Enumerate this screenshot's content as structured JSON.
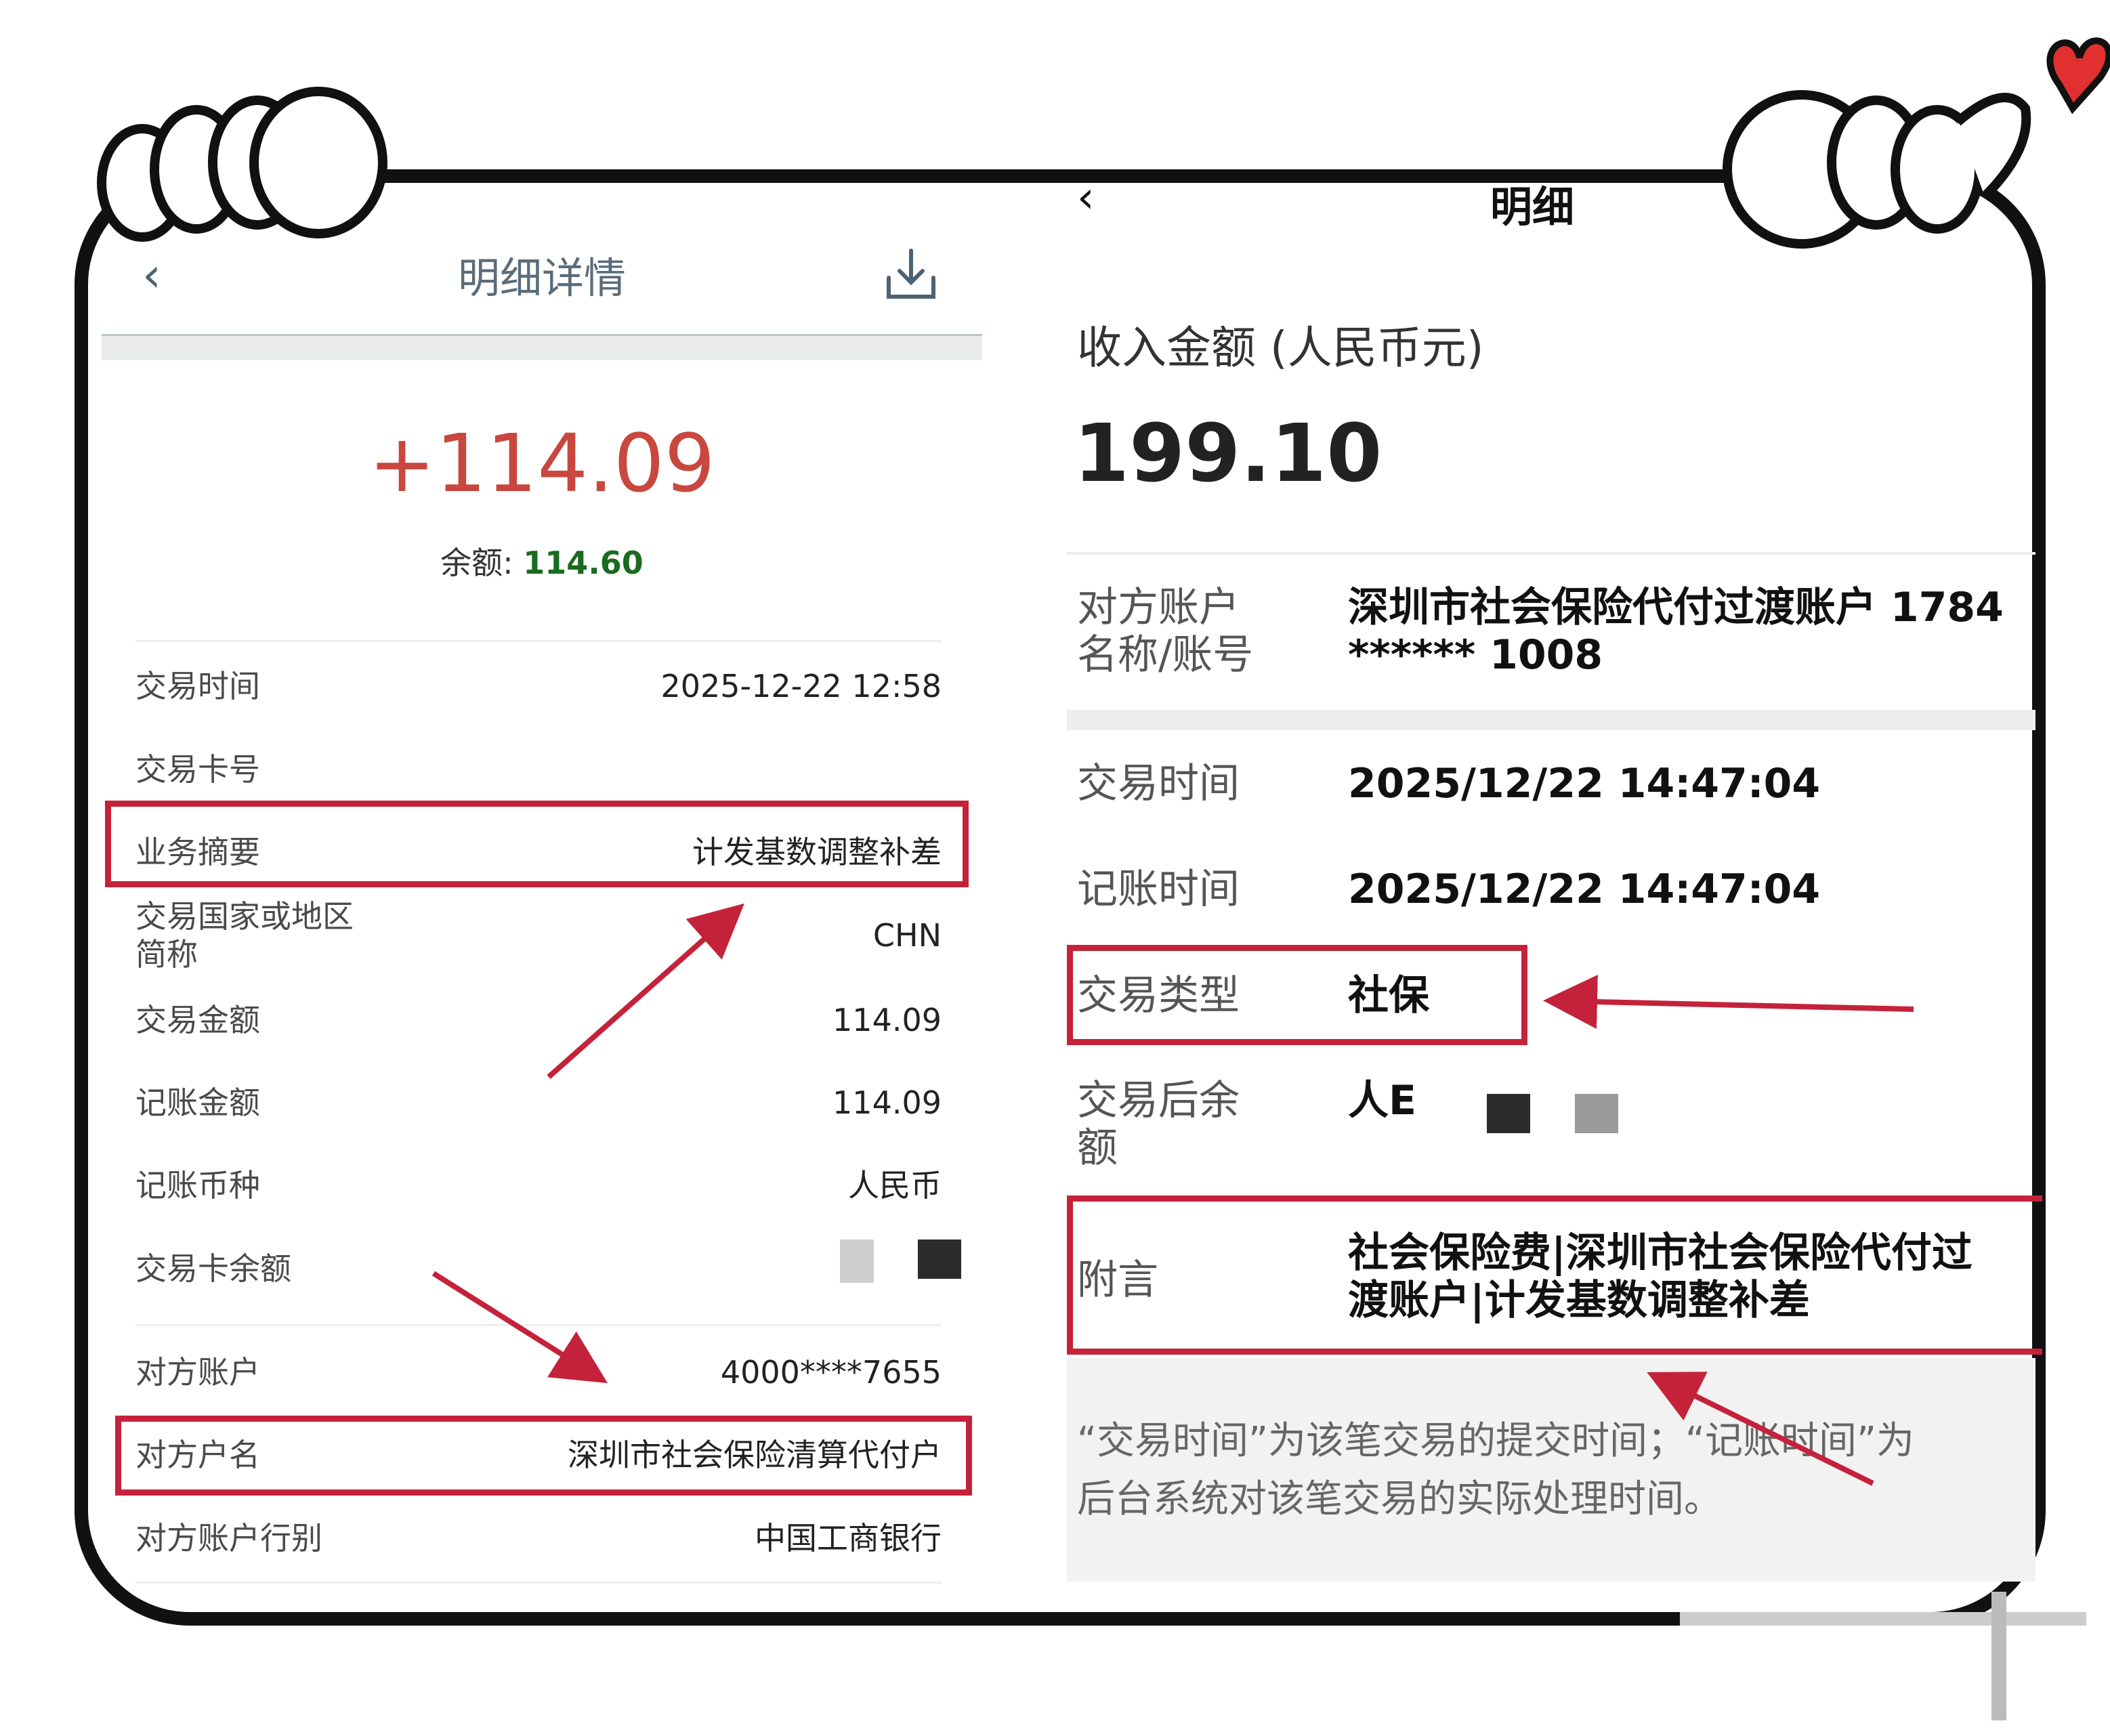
{
  "left_panel": {
    "header": {
      "title": "明细详情",
      "back_icon": "chevron-left-icon",
      "download_icon": "download-icon"
    },
    "amount": "+114.09",
    "balance_label": "余额:",
    "balance_value": "114.60",
    "rows": [
      {
        "label": "交易时间",
        "value": "2025-12-22 12:58"
      },
      {
        "label": "交易卡号",
        "value": ""
      },
      {
        "label": "业务摘要",
        "value": "计发基数调整补差"
      },
      {
        "label": "交易国家或地区简称",
        "label_line1": "交易国家或地区",
        "label_line2": "简称",
        "value": "CHN"
      },
      {
        "label": "交易金额",
        "value": "114.09"
      },
      {
        "label": "记账金额",
        "value": "114.09"
      },
      {
        "label": "记账币种",
        "value": "人民币"
      },
      {
        "label": "交易卡余额",
        "value": ""
      },
      {
        "label": "对方账户",
        "value": "4000****7655"
      },
      {
        "label": "对方户名",
        "value": "深圳市社会保险清算代付户"
      },
      {
        "label": "对方账户行别",
        "value": "中国工商银行"
      }
    ]
  },
  "right_panel": {
    "header": {
      "title": "明细",
      "back_icon": "chevron-left-icon"
    },
    "income_label": "收入金额 (人民币元)",
    "income_amount": "199.10",
    "counterparty": {
      "label_line1": "对方账户",
      "label_line2": "名称/账号",
      "value_line1": "深圳市社会保险代付过渡账户 1784",
      "value_line2": "****** 1008"
    },
    "trade_time": {
      "label": "交易时间",
      "value": "2025/12/22 14:47:04"
    },
    "post_time": {
      "label": "记账时间",
      "value": "2025/12/22 14:47:04"
    },
    "trade_type": {
      "label": "交易类型",
      "value": "社保"
    },
    "balance_after": {
      "label_line1": "交易后余",
      "label_line2": "额",
      "value": "人E"
    },
    "memo": {
      "label": "附言",
      "value_line1": "社会保险费|深圳市社会保险代付过",
      "value_line2": "渡账户|计发基数调整补差"
    },
    "note_line1": "“交易时间”为该笔交易的提交时间；“记账时间”为",
    "note_line2": "后台系统对该笔交易的实际处理时间。"
  },
  "colors": {
    "highlight": "#c4223a",
    "amount_red": "#c8473f",
    "balance_green": "#1a6b20"
  }
}
